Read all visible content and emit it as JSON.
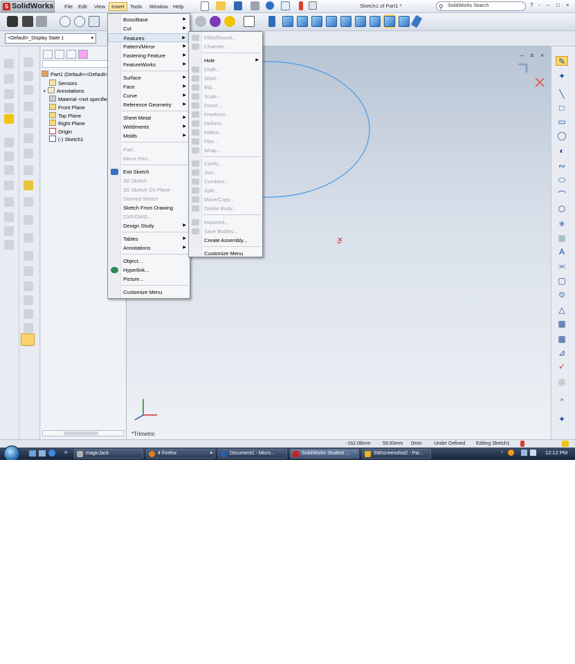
{
  "app": {
    "name": "SolidWorks",
    "document_title": "Sketch1 of Part1 *",
    "search_placeholder": "SolidWorks Search",
    "window_controls": [
      "?",
      "-",
      "−",
      "□",
      "×"
    ]
  },
  "menubar": {
    "items": [
      {
        "label": "File"
      },
      {
        "label": "Edit"
      },
      {
        "label": "View"
      },
      {
        "label": "Insert",
        "active": true
      },
      {
        "label": "Tools"
      },
      {
        "label": "Window"
      },
      {
        "label": "Help"
      }
    ]
  },
  "display_state": {
    "selected": "<Default>_Display State 1"
  },
  "feature_tree": {
    "items": [
      {
        "label": "Part1  (Default<<Default>",
        "icon": "part-icon"
      },
      {
        "label": "Sensors",
        "icon": "sensor-icon"
      },
      {
        "label": "Annotations",
        "icon": "annotations-icon"
      },
      {
        "label": "Material <not specified>",
        "icon": "material-icon"
      },
      {
        "label": "Front Plane",
        "icon": "plane-icon"
      },
      {
        "label": "Top Plane",
        "icon": "plane-icon"
      },
      {
        "label": "Right Plane",
        "icon": "plane-icon"
      },
      {
        "label": "Origin",
        "icon": "origin-icon"
      },
      {
        "label": "(-) Sketch1",
        "icon": "sketch-icon"
      }
    ]
  },
  "insert_menu": {
    "items": [
      {
        "label": "Boss/Base",
        "submenu": true
      },
      {
        "label": "Cut",
        "submenu": true
      },
      {
        "label": "Features",
        "submenu": true,
        "highlighted": true
      },
      {
        "label": "Pattern/Mirror",
        "submenu": true
      },
      {
        "label": "Fastening Feature",
        "submenu": true
      },
      {
        "label": "FeatureWorks",
        "submenu": true
      },
      {
        "separator": true
      },
      {
        "label": "Surface",
        "submenu": true
      },
      {
        "label": "Face",
        "submenu": true
      },
      {
        "label": "Curve",
        "submenu": true
      },
      {
        "label": "Reference Geometry",
        "submenu": true
      },
      {
        "separator": true
      },
      {
        "label": "Sheet Metal",
        "submenu": true
      },
      {
        "label": "Weldments",
        "submenu": true
      },
      {
        "label": "Molds",
        "submenu": true
      },
      {
        "separator": true
      },
      {
        "label": "Part...",
        "disabled": true
      },
      {
        "label": "Mirror Part...",
        "disabled": true
      },
      {
        "separator": true
      },
      {
        "label": "Exit Sketch",
        "icon": "exit-sketch-icon"
      },
      {
        "label": "3D Sketch",
        "disabled": true
      },
      {
        "label": "3D Sketch On Plane",
        "disabled": true
      },
      {
        "label": "Derived Sketch",
        "disabled": true
      },
      {
        "label": "Sketch From Drawing"
      },
      {
        "label": "DXF/DWG...",
        "disabled": true
      },
      {
        "label": "Design Study",
        "submenu": true
      },
      {
        "separator": true
      },
      {
        "label": "Tables",
        "submenu": true
      },
      {
        "label": "Annotations",
        "submenu": true
      },
      {
        "separator": true
      },
      {
        "label": "Object..."
      },
      {
        "label": "Hyperlink...",
        "icon": "hyperlink-icon"
      },
      {
        "label": "Picture..."
      },
      {
        "separator": true
      },
      {
        "label": "Customize Menu"
      }
    ]
  },
  "features_submenu": {
    "items": [
      {
        "label": "Fillet/Round...",
        "disabled": true
      },
      {
        "label": "Chamfer...",
        "disabled": true
      },
      {
        "separator": true
      },
      {
        "label": "Hole",
        "submenu": true
      },
      {
        "label": "Draft...",
        "disabled": true
      },
      {
        "label": "Shell...",
        "disabled": true
      },
      {
        "label": "Rib...",
        "disabled": true
      },
      {
        "label": "Scale...",
        "disabled": true
      },
      {
        "label": "Dome...",
        "disabled": true
      },
      {
        "label": "Freeform...",
        "disabled": true
      },
      {
        "label": "Deform...",
        "disabled": true
      },
      {
        "label": "Indent...",
        "disabled": true
      },
      {
        "label": "Flex...",
        "disabled": true
      },
      {
        "label": "Wrap...",
        "disabled": true
      },
      {
        "separator": true
      },
      {
        "label": "Cavity...",
        "disabled": true
      },
      {
        "label": "Join...",
        "disabled": true
      },
      {
        "label": "Combine...",
        "disabled": true
      },
      {
        "label": "Split...",
        "disabled": true
      },
      {
        "label": "Move/Copy...",
        "disabled": true
      },
      {
        "label": "Delete Body...",
        "disabled": true
      },
      {
        "separator": true
      },
      {
        "label": "Imported...",
        "disabled": true
      },
      {
        "label": "Save Bodies...",
        "disabled": true
      },
      {
        "label": "Create Assembly..."
      },
      {
        "separator": true
      },
      {
        "label": "Customize Menu"
      }
    ]
  },
  "graphics": {
    "view_label": "*Trimetric"
  },
  "status_bar": {
    "x": "-162.08mm",
    "y": "59.93mm",
    "z": "0mm",
    "sketch_state": "Under Defined",
    "mode": "Editing Sketch1"
  },
  "taskbar": {
    "items": [
      {
        "label": "magicJack",
        "color": "#b0b0b0"
      },
      {
        "label": "4 Firefox",
        "color": "#e77c1f"
      },
      {
        "label": "Document1 - Micro...",
        "color": "#2a5caa"
      },
      {
        "label": "SolidWorks Student ...",
        "color": "#c8231d",
        "active": true
      },
      {
        "label": "SWscreenshot2 - Pai...",
        "color": "#e6b422"
      }
    ],
    "clock": "12:12 PM"
  }
}
